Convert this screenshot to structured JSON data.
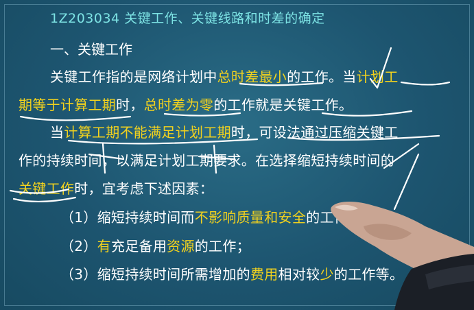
{
  "slide": {
    "title": "1Z203034  关键工作、关键线路和时差的确定",
    "heading": "一、关键工作",
    "line1": {
      "a": "关键工作指的是网络计划中",
      "b": "总时差最小",
      "c": "的工作。当",
      "d": "计划工"
    },
    "line2": {
      "a": "期等于计算工期",
      "b": "时，",
      "c": "总时差为零",
      "d": "的工作就是关键工作。"
    },
    "line3": {
      "a": "当",
      "b": "计算工期不能满足计划工期",
      "c": "时，可设法通过压缩关键工"
    },
    "line4": {
      "a": "作的持续时间，以满足计划工期要求。在选择缩短持续时间的"
    },
    "line5": {
      "a": "关键工作",
      "b": "时，宜考虑下述因素："
    },
    "line6": {
      "a": "（1）缩短持续时间而",
      "b": "不影响质量和安全",
      "c": "的工作；"
    },
    "line7": {
      "a": "（2）",
      "b": "有",
      "c": "充足备用",
      "d": "资源",
      "e": "的工作；"
    },
    "line8": {
      "a": "（3）缩短持续时间所需增加的",
      "b": "费用",
      "c": "相对较",
      "d": "少",
      "e": "的工作等。"
    }
  },
  "colors": {
    "background": "#1d5570",
    "title": "#7de3e4",
    "text": "#ffffff",
    "highlight": "#f2d21e",
    "ink": "#ffffff"
  }
}
